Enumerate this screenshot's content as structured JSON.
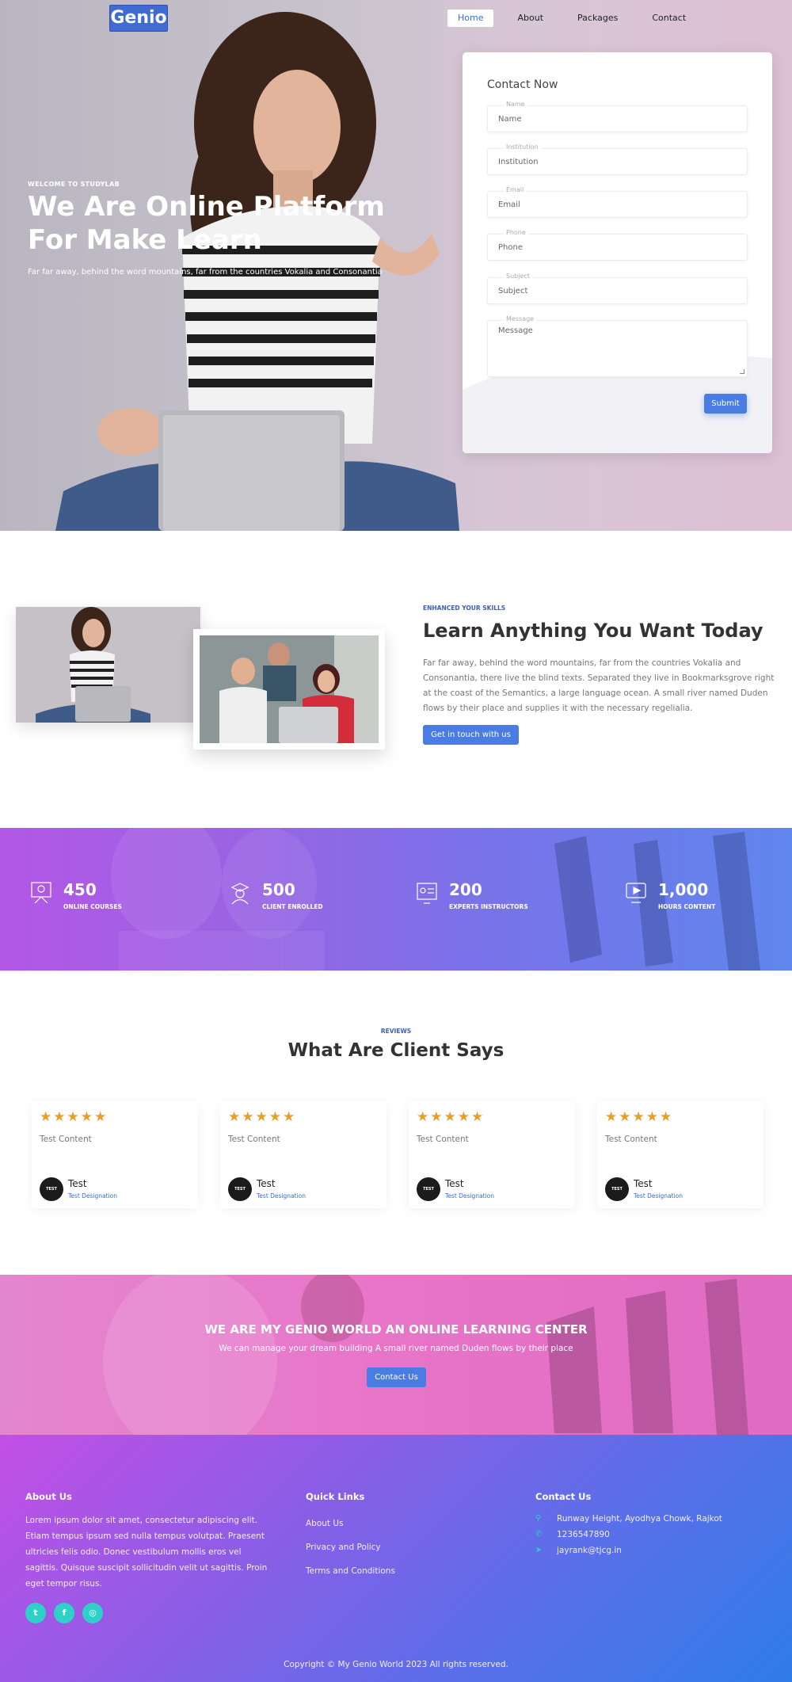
{
  "brand": {
    "logo": "Genio"
  },
  "nav": {
    "items": [
      "Home",
      "About",
      "Packages",
      "Contact"
    ],
    "active": "Home"
  },
  "hero": {
    "eyebrow": "WELCOME TO STUDYLAB",
    "title": "We Are Online Platform For Make Learn",
    "subtitle": "Far far away, behind the word mountains, far from the countries Vokalia and Consonantia"
  },
  "contact_form": {
    "title": "Contact Now",
    "fields": [
      {
        "label": "Name",
        "placeholder": "Name"
      },
      {
        "label": "Institution",
        "placeholder": "Institution"
      },
      {
        "label": "Email",
        "placeholder": "Email"
      },
      {
        "label": "Phone",
        "placeholder": "Phone"
      },
      {
        "label": "Subject",
        "placeholder": "Subject"
      },
      {
        "label": "Message",
        "placeholder": "Message"
      }
    ],
    "submit_label": "Submit"
  },
  "about": {
    "eyebrow": "ENHANCED YOUR SKILLS",
    "title": "Learn Anything You Want Today",
    "text": "Far far away, behind the word mountains, far from the countries Vokalia and Consonantia, there live the blind texts. Separated they live in Bookmarksgrove right at the coast of the Semantics, a large language ocean. A small river named Duden flows by their place and supplies it with the necessary regelialia.",
    "button_label": "Get in touch with us"
  },
  "stats": [
    {
      "value": "450",
      "label": "ONLINE COURSES",
      "icon": "courses-icon"
    },
    {
      "value": "500",
      "label": "CLIENT ENROLLED",
      "icon": "graduate-icon"
    },
    {
      "value": "200",
      "label": "EXPERTS INSTRUCTORS",
      "icon": "instructor-icon"
    },
    {
      "value": "1,000",
      "label": "HOURS CONTENT",
      "icon": "video-content-icon"
    }
  ],
  "reviews": {
    "eyebrow": "REVIEWS",
    "title": "What Are Client Says",
    "rating_stars": "★★★★★",
    "items": [
      {
        "content": "Test Content",
        "name": "Test",
        "designation": "Test Designation",
        "avatar_text": "TEST"
      },
      {
        "content": "Test Content",
        "name": "Test",
        "designation": "Test Designation",
        "avatar_text": "TEST"
      },
      {
        "content": "Test Content",
        "name": "Test",
        "designation": "Test Designation",
        "avatar_text": "TEST"
      },
      {
        "content": "Test Content",
        "name": "Test",
        "designation": "Test Designation",
        "avatar_text": "TEST"
      }
    ]
  },
  "cta": {
    "title": "WE ARE MY GENIO WORLD AN ONLINE LEARNING CENTER",
    "subtitle": "We can manage your dream building A small river named Duden flows by their place",
    "button_label": "Contact Us"
  },
  "footer": {
    "about_heading": "About Us",
    "about_text": "Lorem ipsum dolor sit amet, consectetur adipiscing elit. Etiam tempus ipsum sed nulla tempus volutpat. Praesent ultricies felis odio. Donec vestibulum mollis eros vel sagittis. Quisque suscipit sollicitudin velit ut sagittis. Proin eget tempor risus.",
    "social": [
      {
        "name": "twitter-icon",
        "glyph": "t"
      },
      {
        "name": "facebook-icon",
        "glyph": "f"
      },
      {
        "name": "instagram-icon",
        "glyph": "◎"
      }
    ],
    "quick_links_heading": "Quick Links",
    "quick_links": [
      "About Us",
      "Privacy and Policy",
      "Terms and Conditions"
    ],
    "contact_heading": "Contact Us",
    "contact": {
      "address": "Runway Height, Ayodhya Chowk, Rajkot",
      "phone": "1236547890",
      "email": "jayrank@tjcg.in"
    },
    "copyright": "Copyright © My Genio World 2023 All rights reserved."
  },
  "colors": {
    "accent": "#4a7de4",
    "brand": "#3f6bd3",
    "star": "#e79d29",
    "social": "#2dd1c8"
  }
}
